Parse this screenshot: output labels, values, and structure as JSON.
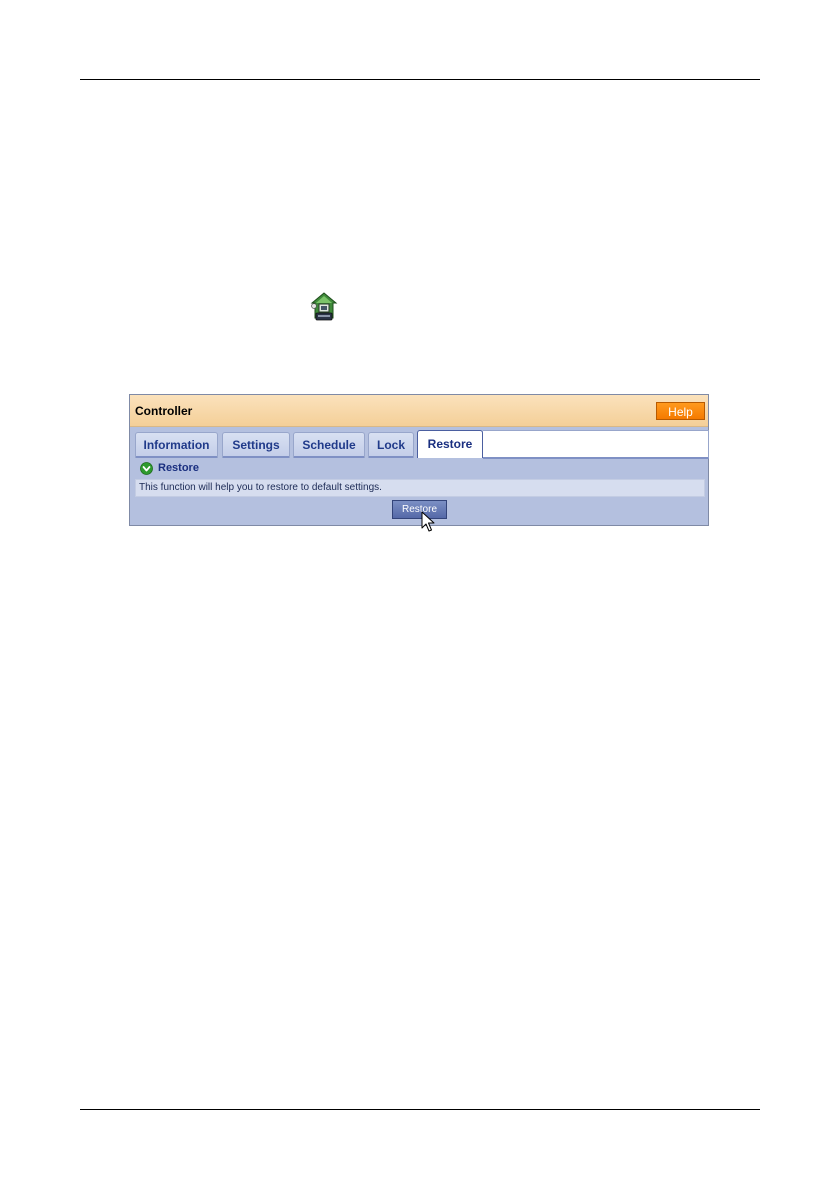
{
  "panel": {
    "title": "Controller",
    "help_label": "Help"
  },
  "tabs": [
    {
      "label": "Information"
    },
    {
      "label": "Settings"
    },
    {
      "label": "Schedule"
    },
    {
      "label": "Lock"
    },
    {
      "label": "Restore"
    }
  ],
  "active_tab": "Restore",
  "section": {
    "heading": "Restore",
    "icon": "green-chevron-down-icon",
    "description": "This function will help you to restore to default settings."
  },
  "restore_button_label": "Restore",
  "page_icons": {
    "controller_icon": "controller-icon",
    "cursor": "mouse-pointer-icon"
  },
  "colors": {
    "header_bg": "#f4cf98",
    "help_button": "#f57a00",
    "panel_bg": "#b4c0df",
    "tab_text": "#203a8a",
    "section_icon": "#2e9a2e",
    "restore_button": "#5569a8"
  }
}
